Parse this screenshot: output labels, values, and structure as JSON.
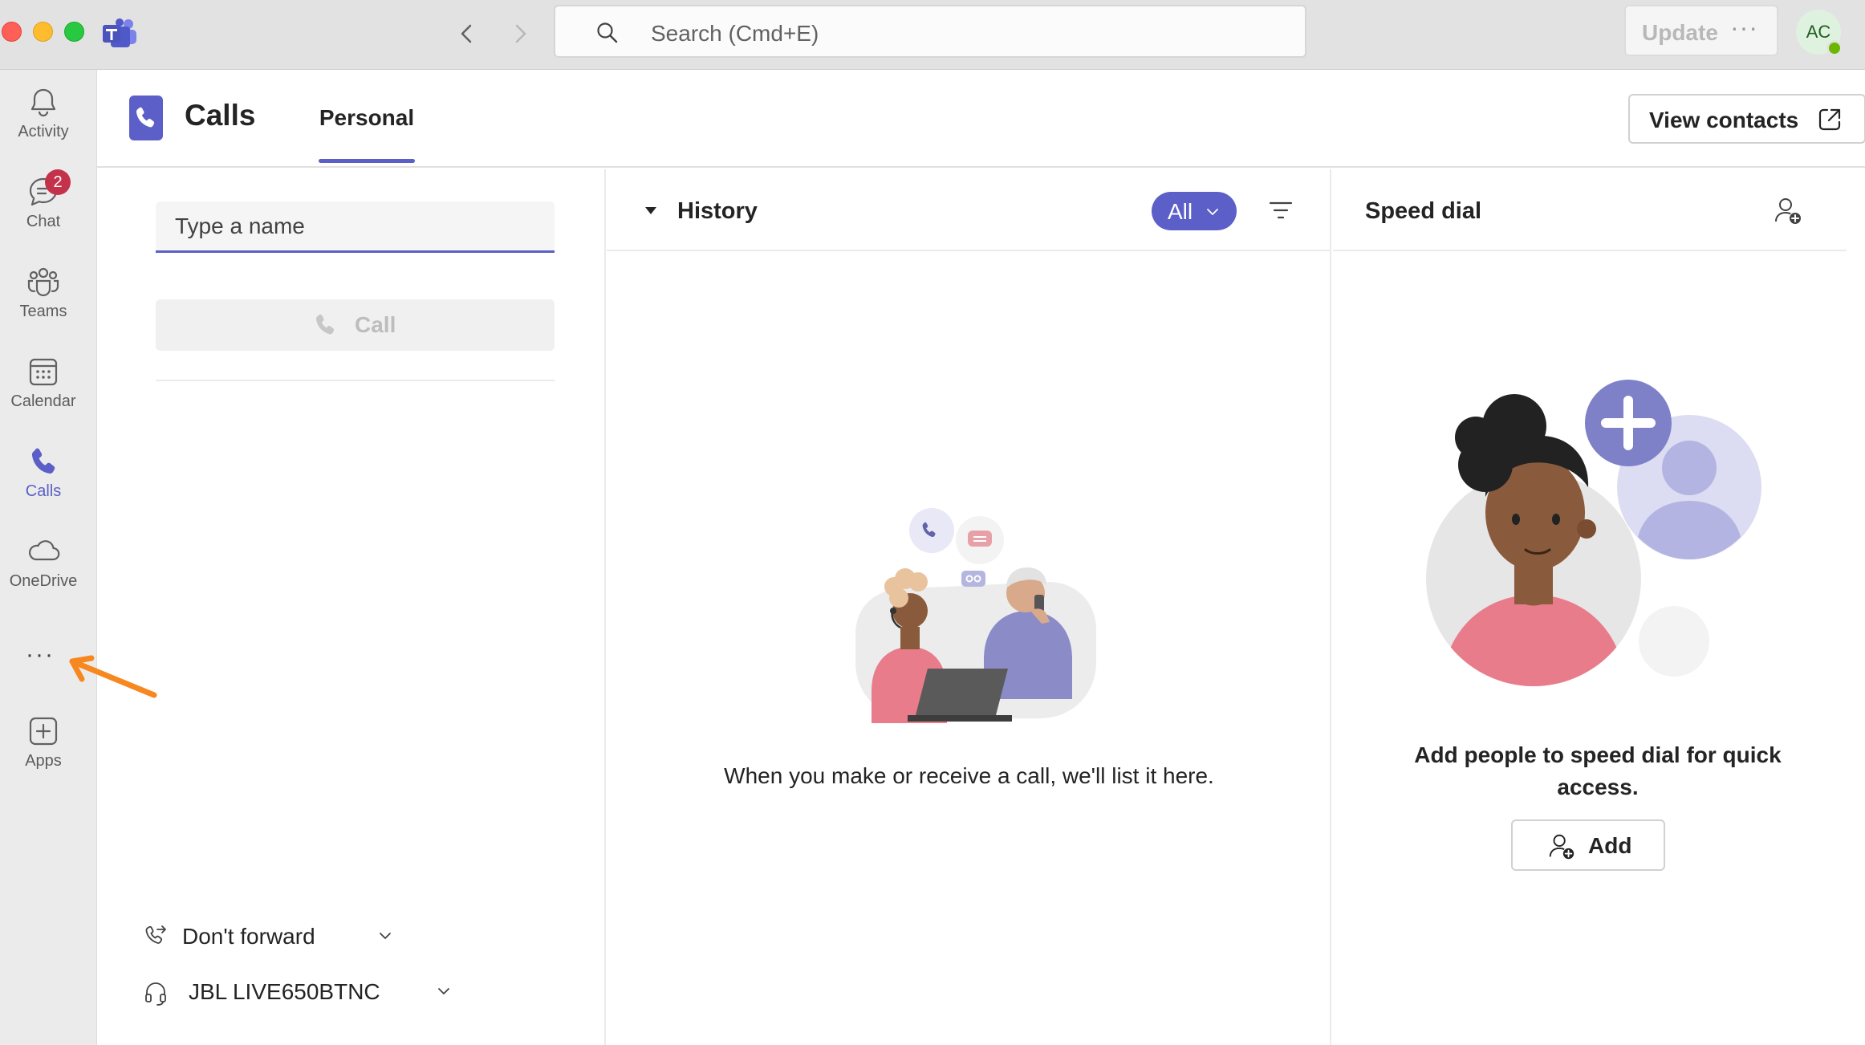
{
  "colors": {
    "accent": "#5b5fc7",
    "badge": "#c4314b",
    "annotation_arrow": "#f7871f",
    "presence_available": "#6bb700"
  },
  "titlebar": {
    "search_placeholder": "Search (Cmd+E)",
    "update_label": "Update",
    "more_label": "···",
    "avatar_initials": "AC"
  },
  "rail": {
    "items": [
      {
        "label": "Activity",
        "icon": "bell-icon"
      },
      {
        "label": "Chat",
        "icon": "chat-icon",
        "badge": "2"
      },
      {
        "label": "Teams",
        "icon": "teams-icon"
      },
      {
        "label": "Calendar",
        "icon": "calendar-icon"
      },
      {
        "label": "Calls",
        "icon": "phone-icon",
        "active": true
      },
      {
        "label": "OneDrive",
        "icon": "cloud-icon"
      },
      {
        "label": "Apps",
        "icon": "add-app-icon"
      }
    ],
    "more_label": "···"
  },
  "header": {
    "title": "Calls",
    "tabs": [
      {
        "label": "Personal",
        "selected": true
      }
    ],
    "view_contacts_label": "View contacts"
  },
  "dialer": {
    "name_placeholder": "Type a name",
    "call_label": "Call",
    "forward_label": "Don't forward",
    "device_label": "JBL LIVE650BTNC"
  },
  "history": {
    "title": "History",
    "filter_label": "All",
    "empty_message": "When you make or receive a call, we'll list it here."
  },
  "speed_dial": {
    "title": "Speed dial",
    "empty_message": "Add people to speed dial for quick access.",
    "add_label": "Add"
  }
}
